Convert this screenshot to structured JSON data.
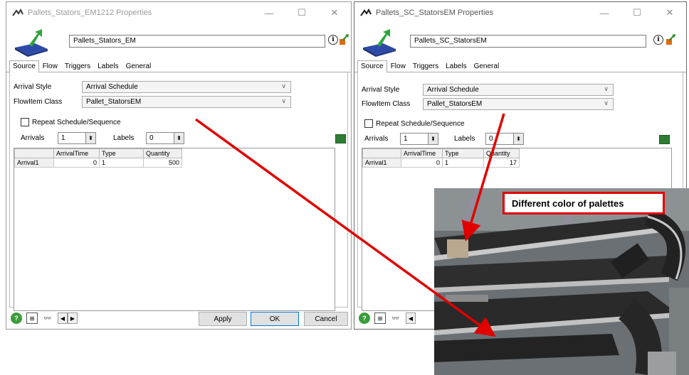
{
  "windows": [
    {
      "title": "Pallets_Stators_EM1212  Properties",
      "object_name": "Pallets_Stators_EM",
      "tabs": [
        "Source",
        "Flow",
        "Triggers",
        "Labels",
        "General"
      ],
      "arrival_style_label": "Arrival Style",
      "arrival_style_value": "Arrival Schedule",
      "flowitem_label": "FlowItem Class",
      "flowitem_value": "Pallet_StatorsEM",
      "repeat_label": "Repeat Schedule/Sequence",
      "arrivals_label": "Arrivals",
      "arrivals_value": "1",
      "labels_label": "Labels",
      "labels_value": "0",
      "table_headers": [
        "",
        "ArrivalTime",
        "Type",
        "Quantity"
      ],
      "table_rows": [
        [
          "Arrival1",
          "0",
          "1",
          "500"
        ]
      ],
      "apply_label": "Apply",
      "ok_label": "OK",
      "cancel_label": "Cancel"
    },
    {
      "title": "Pallets_SC_StatorsEM  Properties",
      "object_name": "Pallets_SC_StatorsEM",
      "tabs": [
        "Source",
        "Flow",
        "Triggers",
        "Labels",
        "General"
      ],
      "arrival_style_label": "Arrival Style",
      "arrival_style_value": "Arrival Schedule",
      "flowitem_label": "FlowItem Class",
      "flowitem_value": "Pallet_StatorsEM",
      "repeat_label": "Repeat Schedule/Sequence",
      "arrivals_label": "Arrivals",
      "arrivals_value": "1",
      "labels_label": "Labels",
      "labels_value": "0",
      "table_headers": [
        "",
        "ArrivalTime",
        "Type",
        "Quantity"
      ],
      "table_rows": [
        [
          "Arrival1",
          "0",
          "1",
          "17"
        ]
      ]
    }
  ],
  "callout": {
    "text": "Different color of palettes"
  },
  "colors": {
    "accent_red": "#e00000",
    "button_default_border": "#0078d7",
    "help_green": "#3a9d3a"
  },
  "icons": [
    "flexsim-logo-icon",
    "source-object-icon",
    "info-icon",
    "export-icon",
    "excel-icon",
    "help-icon",
    "tree-icon",
    "binoculars-icon",
    "arrow-left-icon",
    "arrow-right-icon",
    "minimize-icon",
    "maximize-icon",
    "close-icon"
  ]
}
